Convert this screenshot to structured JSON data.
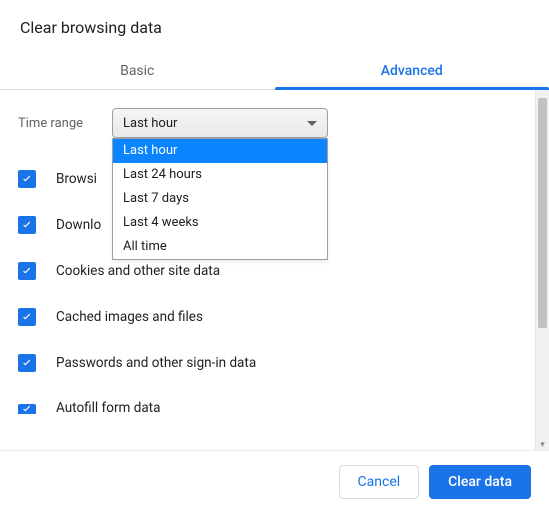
{
  "dialog": {
    "title": "Clear browsing data"
  },
  "tabs": {
    "basic": "Basic",
    "advanced": "Advanced"
  },
  "time_range": {
    "label": "Time range",
    "selected": "Last hour",
    "options": [
      "Last hour",
      "Last 24 hours",
      "Last 7 days",
      "Last 4 weeks",
      "All time"
    ]
  },
  "items": [
    {
      "label": "Browsing history",
      "visible_label": "Browsi",
      "checked": true
    },
    {
      "label": "Download history",
      "visible_label": "Downlo",
      "checked": true
    },
    {
      "label": "Cookies and other site data",
      "visible_label": "Cookies and other site data",
      "checked": true
    },
    {
      "label": "Cached images and files",
      "visible_label": "Cached images and files",
      "checked": true
    },
    {
      "label": "Passwords and other sign-in data",
      "visible_label": "Passwords and other sign-in data",
      "checked": true
    },
    {
      "label": "Autofill form data",
      "visible_label": "Autofill form data",
      "checked": true
    }
  ],
  "footer": {
    "cancel": "Cancel",
    "clear": "Clear data"
  },
  "colors": {
    "accent": "#1a73e8",
    "dropdown_highlight": "#0a84ff"
  }
}
